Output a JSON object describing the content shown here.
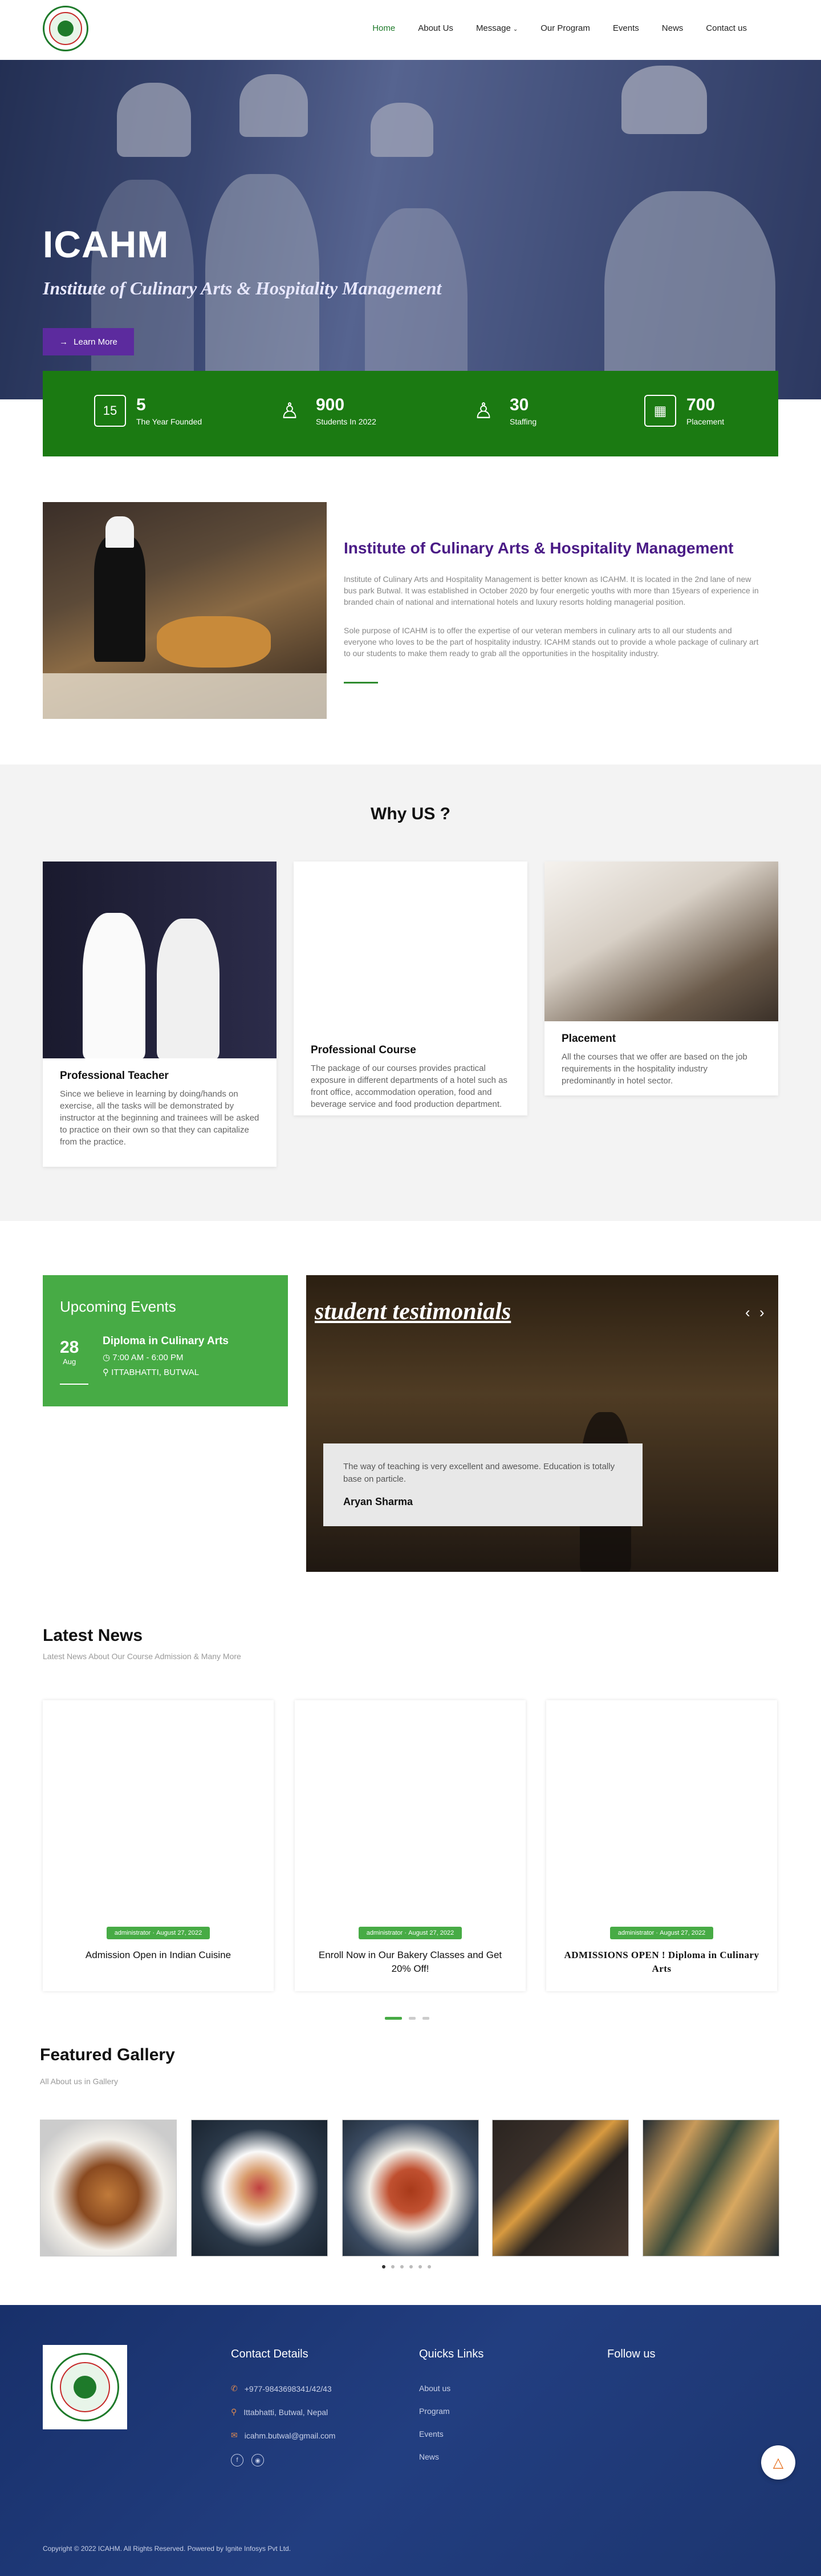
{
  "header": {
    "nav": [
      {
        "label": "Home"
      },
      {
        "label": "About Us"
      },
      {
        "label": "Message"
      },
      {
        "label": "Our Program"
      },
      {
        "label": "Events"
      },
      {
        "label": "News"
      },
      {
        "label": "Contact us"
      }
    ]
  },
  "hero": {
    "title": "ICAHM",
    "subtitle": "Institute of Culinary Arts & Hospitality Management",
    "button": "Learn More"
  },
  "stats": [
    {
      "icon": "calendar-icon",
      "icon_text": "15",
      "number": "5",
      "label": "The Year Founded"
    },
    {
      "icon": "students-icon",
      "number": "900",
      "label": "Students In 2022"
    },
    {
      "icon": "staff-icon",
      "number": "30",
      "label": "Staffing"
    },
    {
      "icon": "placement-icon",
      "number": "700",
      "label": "Placement"
    }
  ],
  "about": {
    "title": "Institute of Culinary Arts & Hospitality Management",
    "para1": "Institute of Culinary Arts and Hospitality Management is better known as ICAHM. It is located in the 2nd lane of new bus park Butwal. It was established in October 2020 by four energetic youths with more than 15years of experience in branded chain of national and international hotels and luxury resorts holding managerial position.",
    "para2": "Sole purpose of ICAHM is to offer the expertise of our veteran members in culinary arts to all our students and everyone who loves to be the part of hospitality industry. ICAHM stands out to provide a whole package of culinary art to our students to make them ready to grab all the opportunities in the hospitality industry."
  },
  "why": {
    "title": "Why US ?",
    "cards": [
      {
        "title": "Professional Teacher",
        "text": "Since we believe in learning by doing/hands on exercise, all the tasks will be demonstrated by instructor at the beginning and trainees will be asked to practice on their own so that they can capitalize from the practice."
      },
      {
        "title": "Professional Course",
        "text": "The package of our courses provides practical exposure in different departments of a hotel such as front office, accommodation operation, food and beverage service and food production department."
      },
      {
        "title": "Placement",
        "text": "All the courses that we offer are based on the job requirements in the hospitality industry predominantly in hotel sector."
      }
    ]
  },
  "events": {
    "heading": "Upcoming Events",
    "day": "28",
    "month": "Aug",
    "title": "Diploma in Culinary Arts",
    "time": "7:00 AM - 6:00 PM",
    "place": "ITTABHATTI, BUTWAL"
  },
  "testimonial": {
    "heading": "student testimonials",
    "quote": "The way of teaching is very excellent and awesome. Education is totally base on particle.",
    "name": "Aryan Sharma"
  },
  "news": {
    "title": "Latest News",
    "subtitle": "Latest News About Our Course Admission & Many More",
    "items": [
      {
        "author": "administrator",
        "date": "August 27, 2022",
        "title": "Admission Open in Indian Cuisine"
      },
      {
        "author": "administrator",
        "date": "August 27, 2022",
        "title": "Enroll Now in Our Bakery Classes and Get 20% Off!"
      },
      {
        "author": "administrator",
        "date": "August 27, 2022",
        "title": "ADMISSIONS OPEN ! Diploma in Culinary Arts"
      }
    ]
  },
  "gallery": {
    "title": "Featured Gallery",
    "subtitle": "All About us in Gallery"
  },
  "footer": {
    "contact_title": "Contact Details",
    "phone": "+977-9843698341/42/43",
    "address": "Ittabhatti, Butwal, Nepal",
    "email": "icahm.butwal@gmail.com",
    "links_title": "Quicks Links",
    "links": [
      "About us",
      "Program",
      "Events",
      "News"
    ],
    "follow_title": "Follow us",
    "copyright": "Copyright © 2022 ICAHM. All Rights Reserved. Powered by Ignite Infosys Pvt Ltd."
  },
  "colors": {
    "brand_green": "#1b7a12",
    "accent_green": "#47ab45",
    "purple": "#5c2b9e",
    "footer_blue": "#1c356f"
  }
}
